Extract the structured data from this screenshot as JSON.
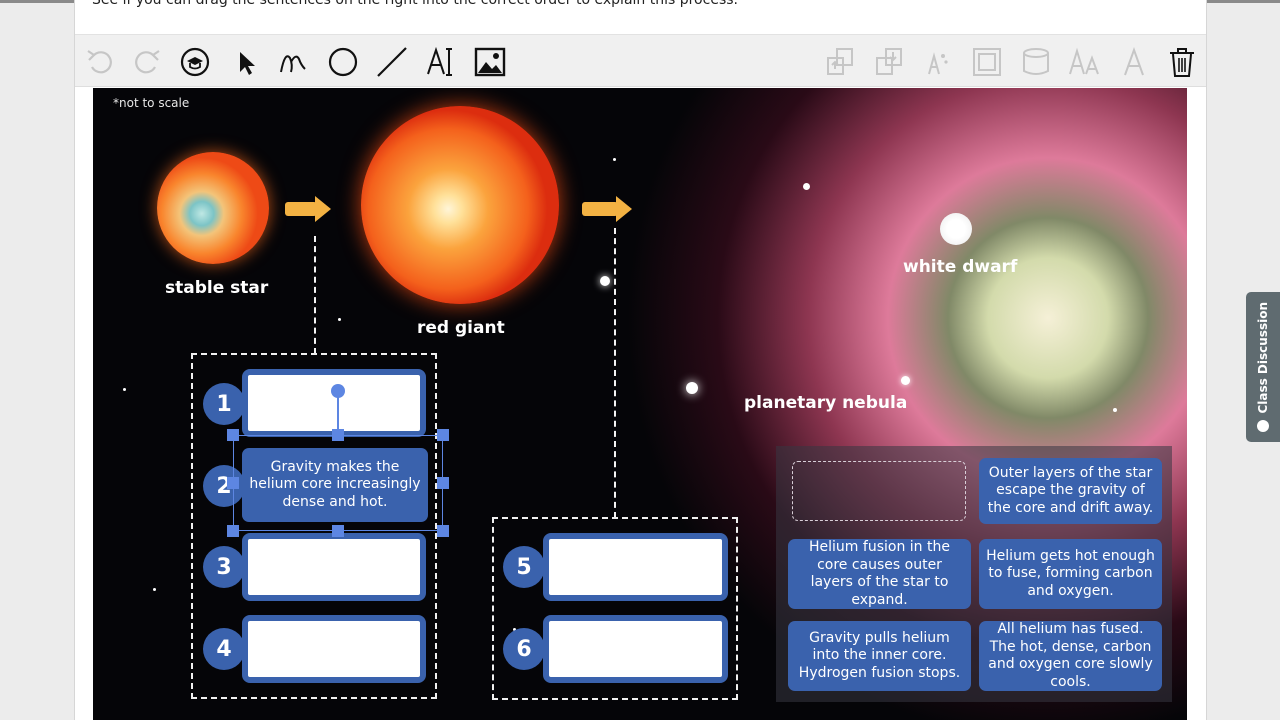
{
  "instruction": "See if you can drag the sentences on the right into the correct order to explain this process.",
  "toolbar": {
    "left": [
      "undo",
      "redo",
      "reset",
      "select",
      "draw",
      "circle",
      "line",
      "text",
      "image"
    ],
    "right": [
      "bring-forward",
      "send-backward",
      "fill",
      "border",
      "shape-style",
      "font-size",
      "text-color",
      "delete"
    ]
  },
  "image": {
    "note": "*not to scale",
    "labels": {
      "stable_star": "stable star",
      "red_giant": "red giant",
      "white_dwarf": "white dwarf",
      "planetary_nebula": "planetary nebula"
    }
  },
  "sequence": {
    "numbers": [
      "1",
      "2",
      "3",
      "4",
      "5",
      "6"
    ],
    "placed_card": "Gravity makes the helium core increasingly dense and hot."
  },
  "cards": [
    "Outer layers of the star escape the gravity of the core and drift away.",
    "Helium fusion in the core causes outer layers of the star to expand.",
    "Helium gets hot enough to fuse, forming carbon and oxygen.",
    "Gravity pulls helium into the inner core. Hydrogen fusion stops.",
    "All helium has fused. The hot, dense, carbon and oxygen core slowly cools."
  ],
  "side_tab": {
    "label": "Class Discussion"
  },
  "colors": {
    "card_blue": "#3a62ad",
    "arrow": "#f3b243",
    "selection": "#5d86e2",
    "side_tab": "#5f6b70"
  }
}
